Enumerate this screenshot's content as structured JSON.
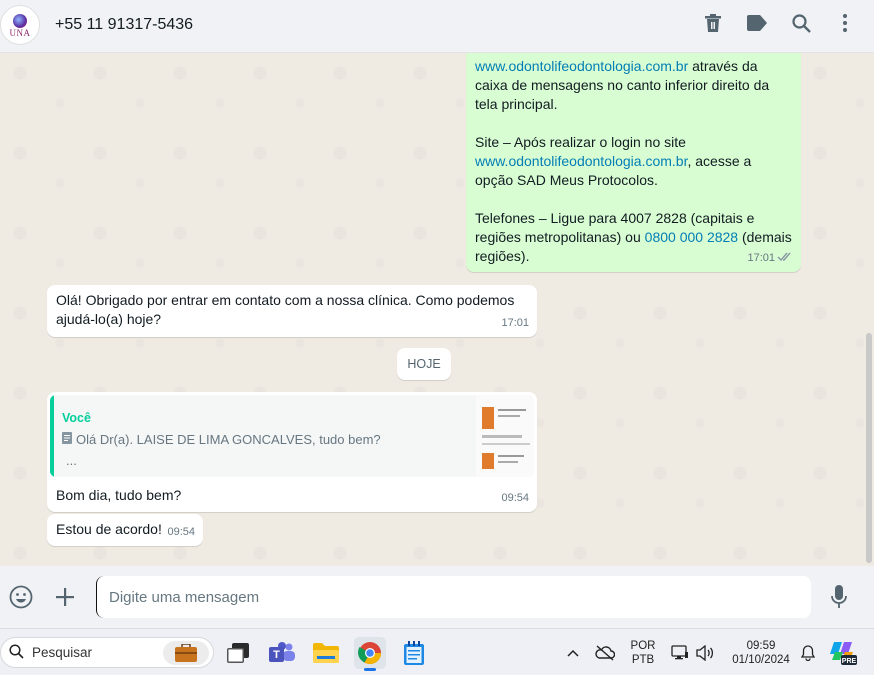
{
  "contact": {
    "logo_text": "UNA",
    "phone": "+55 11 91317-5436"
  },
  "messages": {
    "m1": {
      "line1_link": "www.odontolifeodontologia.com.br",
      "line1_rest": " através da caixa de mensagens no canto inferior direito da tela principal.",
      "site_prefix": "Site – Após realizar o login no site ",
      "site_link": "www.odontolifeodontologia.com.br",
      "site_rest": ", acesse a opção SAD Meus Protocolos.",
      "phone_prefix": "Telefones – Ligue para 4007 2828 (capitais e regiões metropolitanas) ou ",
      "phone_link": "0800 000 2828",
      "phone_rest": " (demais regiões).",
      "time": "17:01"
    },
    "m2": {
      "text": "Olá! Obrigado por entrar em contato com a nossa clínica. Como podemos ajudá-lo(a) hoje?",
      "time": "17:01"
    },
    "day_divider": "HOJE",
    "m3": {
      "quote_author": "Você",
      "quote_text": "Olá Dr(a). LAISE DE LIMA GONCALVES, tudo bem?",
      "quote_more": "...",
      "text": "Bom dia, tudo bem?",
      "time": "09:54"
    },
    "m4": {
      "text": "Estou de acordo!",
      "time": "09:54"
    }
  },
  "composer": {
    "placeholder": "Digite uma mensagem"
  },
  "taskbar": {
    "search_placeholder": "Pesquisar",
    "lang_line1": "POR",
    "lang_line2": "PTB",
    "clock_time": "09:59",
    "clock_date": "01/10/2024",
    "copilot_badge": "PRE"
  },
  "colors": {
    "outgoing_bubble": "#d9fdd3",
    "incoming_bubble": "#ffffff",
    "accent": "#06cf9c",
    "link": "#027eb5"
  }
}
